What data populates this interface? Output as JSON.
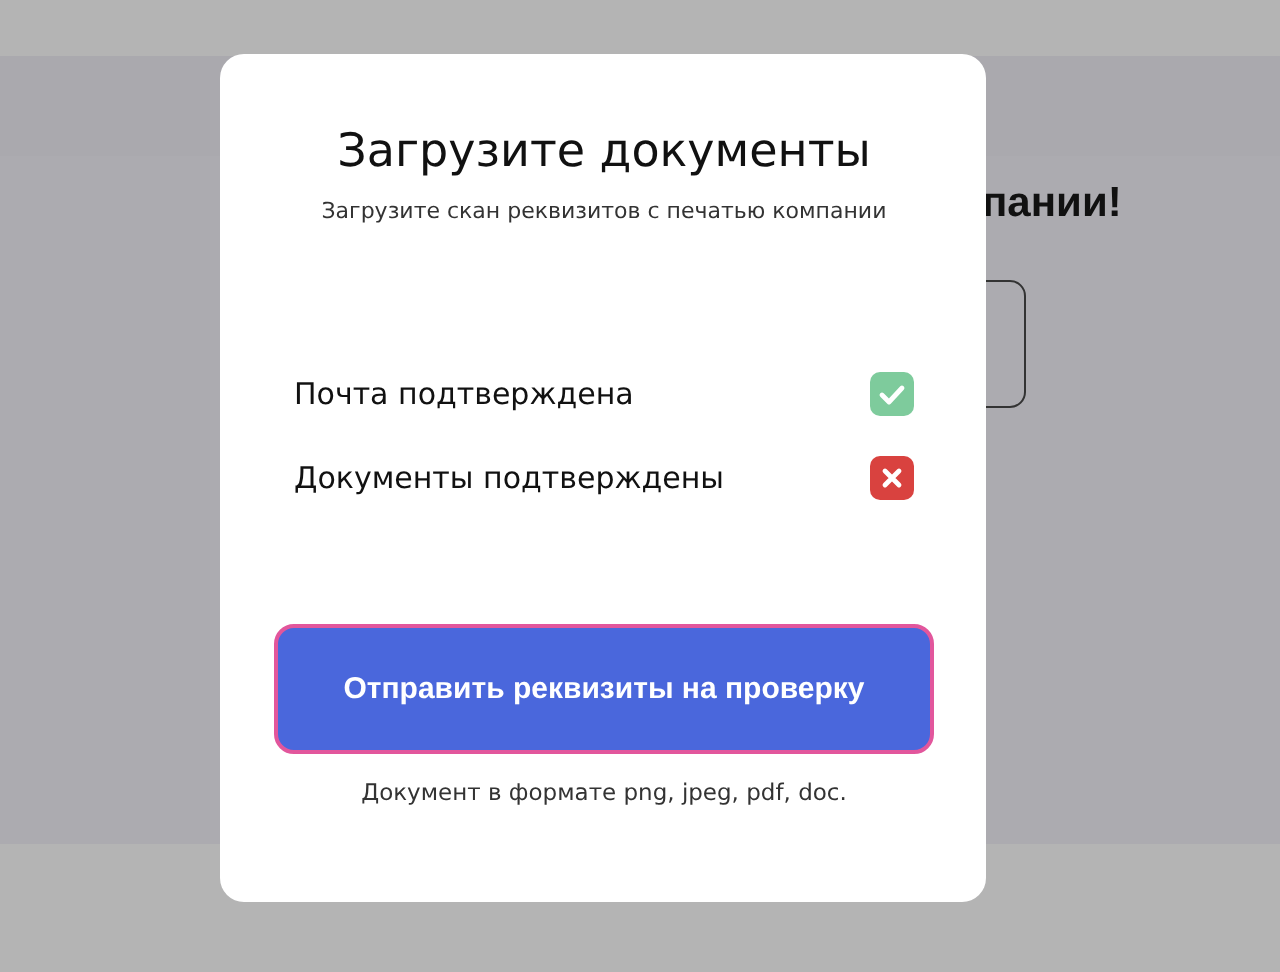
{
  "background_page": {
    "heading": "пании!"
  },
  "modal": {
    "title": "Загрузите документы",
    "subtitle": "Загрузите скан реквизитов с печатью компании",
    "checks": [
      {
        "label": "Почта подтверждена",
        "confirmed": true
      },
      {
        "label": "Документы подтверждены",
        "confirmed": false
      }
    ],
    "submit_button": "Отправить реквизиты на проверку",
    "note": "Документ в формате png, jpeg, pdf, doc."
  }
}
